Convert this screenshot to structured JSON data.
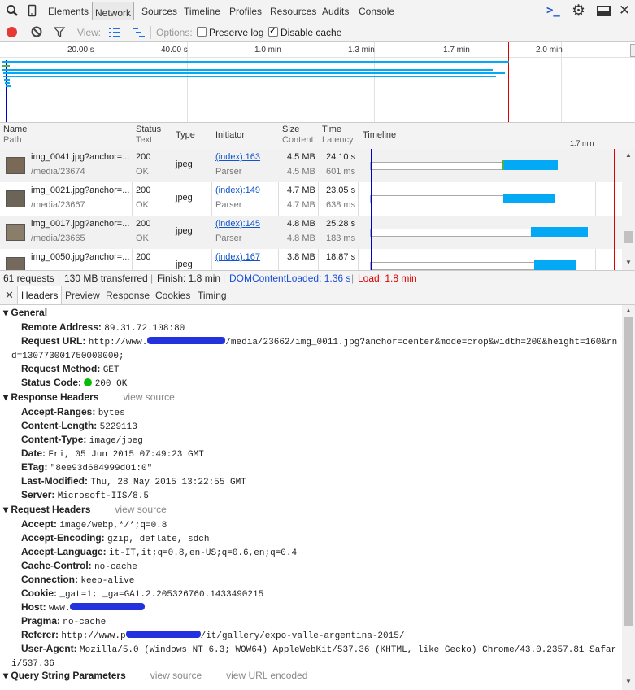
{
  "toolbar": {
    "tabs": [
      "Elements",
      "Network",
      "Sources",
      "Timeline",
      "Profiles",
      "Resources",
      "Audits",
      "Console"
    ],
    "selected": "Network"
  },
  "filterbar": {
    "view_label": "View:",
    "options_label": "Options:",
    "preserve_log": "Preserve log",
    "preserve_log_checked": false,
    "disable_cache": "Disable cache",
    "disable_cache_checked": true
  },
  "overview": {
    "ticks": [
      "20.00 s",
      "40.00 s",
      "1.0 min",
      "1.3 min",
      "1.7 min",
      "2.0 min"
    ]
  },
  "table": {
    "headers": {
      "name": "Name",
      "path": "Path",
      "status": "Status",
      "text": "Text",
      "type": "Type",
      "initiator": "Initiator",
      "size": "Size",
      "content": "Content",
      "time": "Time",
      "latency": "Latency",
      "timeline": "Timeline",
      "timeline_tick": "1.7 min"
    },
    "rows": [
      {
        "name": "img_0041.jpg?anchor=...",
        "path": "/media/23674",
        "status": "200",
        "text": "OK",
        "type": "jpeg",
        "initiator": "(index):163",
        "initiator_type": "Parser",
        "size": "4.5 MB",
        "content": "4.5 MB",
        "time": "24.10 s",
        "latency": "601 ms"
      },
      {
        "name": "img_0021.jpg?anchor=...",
        "path": "/media/23667",
        "status": "200",
        "text": "OK",
        "type": "jpeg",
        "initiator": "(index):149",
        "initiator_type": "Parser",
        "size": "4.7 MB",
        "content": "4.7 MB",
        "time": "23.05 s",
        "latency": "638 ms"
      },
      {
        "name": "img_0017.jpg?anchor=...",
        "path": "/media/23665",
        "status": "200",
        "text": "OK",
        "type": "jpeg",
        "initiator": "(index):145",
        "initiator_type": "Parser",
        "size": "4.8 MB",
        "content": "4.8 MB",
        "time": "25.28 s",
        "latency": "183 ms"
      },
      {
        "name": "img_0050.jpg?anchor=...",
        "path": "",
        "status": "200",
        "text": "",
        "type": "jpeg",
        "initiator": "(index):167",
        "initiator_type": "",
        "size": "3.8 MB",
        "content": "",
        "time": "18.87 s",
        "latency": ""
      }
    ]
  },
  "status_bar": {
    "requests": "61 requests",
    "transferred": "130 MB transferred",
    "finish": "Finish: 1.8 min",
    "dom": "DOMContentLoaded: 1.36 s",
    "load": "Load: 1.8 min"
  },
  "detail_tabs": [
    "Headers",
    "Preview",
    "Response",
    "Cookies",
    "Timing"
  ],
  "general": {
    "title": "General",
    "items": [
      {
        "k": "Remote Address:",
        "v": "89.31.72.108:80"
      },
      {
        "k": "Request URL:",
        "v1": "http://www.",
        "v2": "/media/23662/img_0011.jpg?anchor=center&mode=crop&width=200&height=160&rn",
        "v3": "d=130773001750000000;"
      },
      {
        "k": "Request Method:",
        "v": "GET"
      },
      {
        "k": "Status Code:",
        "v": "200 OK"
      }
    ]
  },
  "response_headers": {
    "title": "Response Headers",
    "view_source": "view source",
    "items": [
      {
        "k": "Accept-Ranges:",
        "v": "bytes"
      },
      {
        "k": "Content-Length:",
        "v": "5229113"
      },
      {
        "k": "Content-Type:",
        "v": "image/jpeg"
      },
      {
        "k": "Date:",
        "v": "Fri, 05 Jun 2015 07:49:23 GMT"
      },
      {
        "k": "ETag:",
        "v": "\"8ee93d684999d01:0\""
      },
      {
        "k": "Last-Modified:",
        "v": "Thu, 28 May 2015 13:22:55 GMT"
      },
      {
        "k": "Server:",
        "v": "Microsoft-IIS/8.5"
      }
    ]
  },
  "request_headers": {
    "title": "Request Headers",
    "view_source": "view source",
    "items": [
      {
        "k": "Accept:",
        "v": "image/webp,*/*;q=0.8"
      },
      {
        "k": "Accept-Encoding:",
        "v": "gzip, deflate, sdch"
      },
      {
        "k": "Accept-Language:",
        "v": "it-IT,it;q=0.8,en-US;q=0.6,en;q=0.4"
      },
      {
        "k": "Cache-Control:",
        "v": "no-cache"
      },
      {
        "k": "Connection:",
        "v": "keep-alive"
      },
      {
        "k": "Cookie:",
        "v": "_gat=1; _ga=GA1.2.205326760.1433490215"
      },
      {
        "k": "Host:",
        "v": "www."
      },
      {
        "k": "Pragma:",
        "v": "no-cache"
      },
      {
        "k": "Referer:",
        "v1": "http://www.p",
        "v2": "/it/gallery/expo-valle-argentina-2015/"
      },
      {
        "k": "User-Agent:",
        "v1": "Mozilla/5.0 (Windows NT 6.3; WOW64) AppleWebKit/537.36 (KHTML, like Gecko) Chrome/43.0.2357.81 Safar",
        "v2": "i/537.36"
      }
    ]
  },
  "query_params": {
    "title": "Query String Parameters",
    "view_source": "view source",
    "view_url_encoded": "view URL encoded"
  },
  "colors": {
    "accent": "#1155cc",
    "load": "#dd0000",
    "dom": "#0000cc",
    "bar": "#03a9f4",
    "record": "#e53935"
  }
}
